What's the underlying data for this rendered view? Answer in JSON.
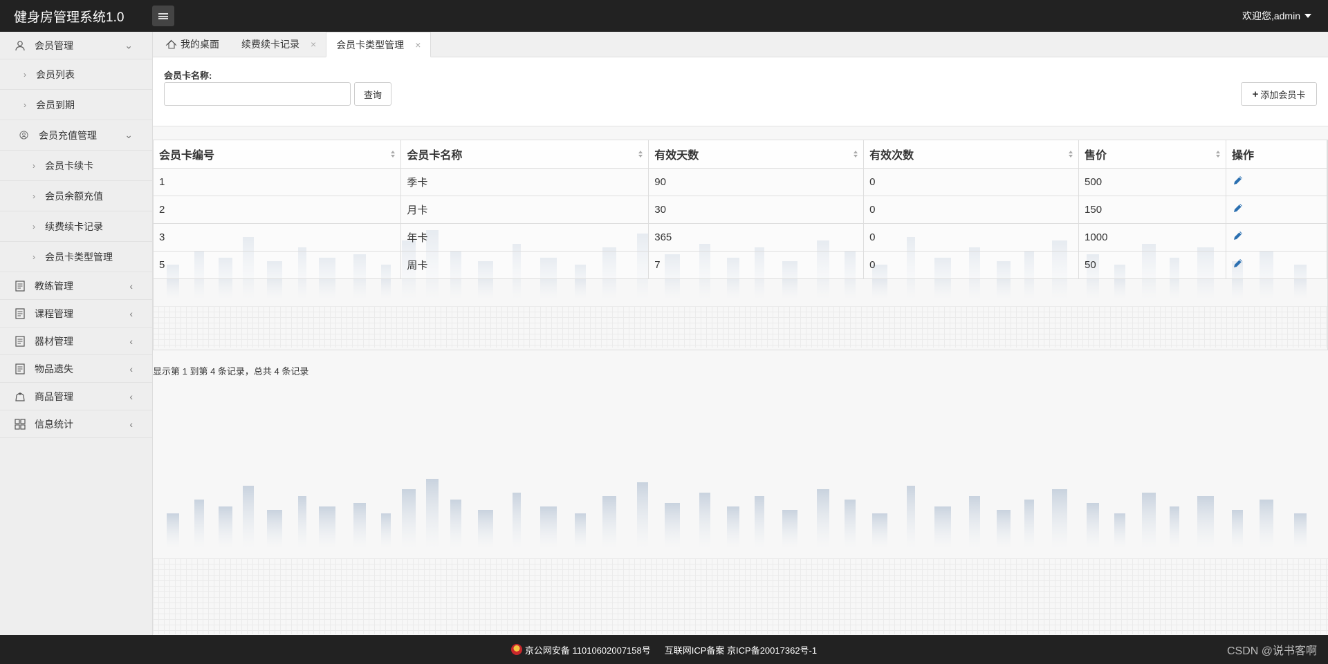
{
  "app": {
    "title": "健身房管理系统1.0",
    "user_greeting": "欢迎您,admin"
  },
  "sidebar": {
    "groups": [
      {
        "label": "会员管理",
        "icon": "user-icon",
        "expanded": true
      },
      {
        "label": "教练管理",
        "icon": "document-icon"
      },
      {
        "label": "课程管理",
        "icon": "document-icon"
      },
      {
        "label": "器材管理",
        "icon": "document-icon"
      },
      {
        "label": "物品遗失",
        "icon": "document-icon"
      },
      {
        "label": "商品管理",
        "icon": "bag-icon"
      },
      {
        "label": "信息统计",
        "icon": "grid-icon"
      }
    ],
    "member_items": [
      "会员列表",
      "会员到期"
    ],
    "recharge_group": "会员充值管理",
    "recharge_items": [
      "会员卡续卡",
      "会员余额充值",
      "续费续卡记录",
      "会员卡类型管理"
    ]
  },
  "tabs": [
    {
      "label": "我的桌面",
      "icon": "home-icon"
    },
    {
      "label": "续费续卡记录"
    },
    {
      "label": "会员卡类型管理",
      "active": true
    }
  ],
  "search": {
    "label": "会员卡名称:",
    "value": "",
    "placeholder": "",
    "search_button": "查询",
    "add_button": "添加会员卡"
  },
  "table": {
    "headers": [
      "会员卡编号",
      "会员卡名称",
      "有效天数",
      "有效次数",
      "售价",
      "操作"
    ],
    "rows": [
      [
        "1",
        "季卡",
        "90",
        "0",
        "500"
      ],
      [
        "2",
        "月卡",
        "30",
        "0",
        "150"
      ],
      [
        "3",
        "年卡",
        "365",
        "0",
        "1000"
      ],
      [
        "5",
        "周卡",
        "7",
        "0",
        "50"
      ]
    ]
  },
  "pager": {
    "summary": "显示第 1 到第 4 条记录，总共 4 条记录"
  },
  "footer": {
    "police": "京公网安备 11010602007158号",
    "icp": "互联网ICP备案 京ICP备20017362号-1",
    "watermark": "CSDN @说书客啊"
  },
  "colors": {
    "header_bg": "#222222",
    "sidebar_bg": "#eeeeee",
    "edit_icon": "#2a6fb0"
  }
}
